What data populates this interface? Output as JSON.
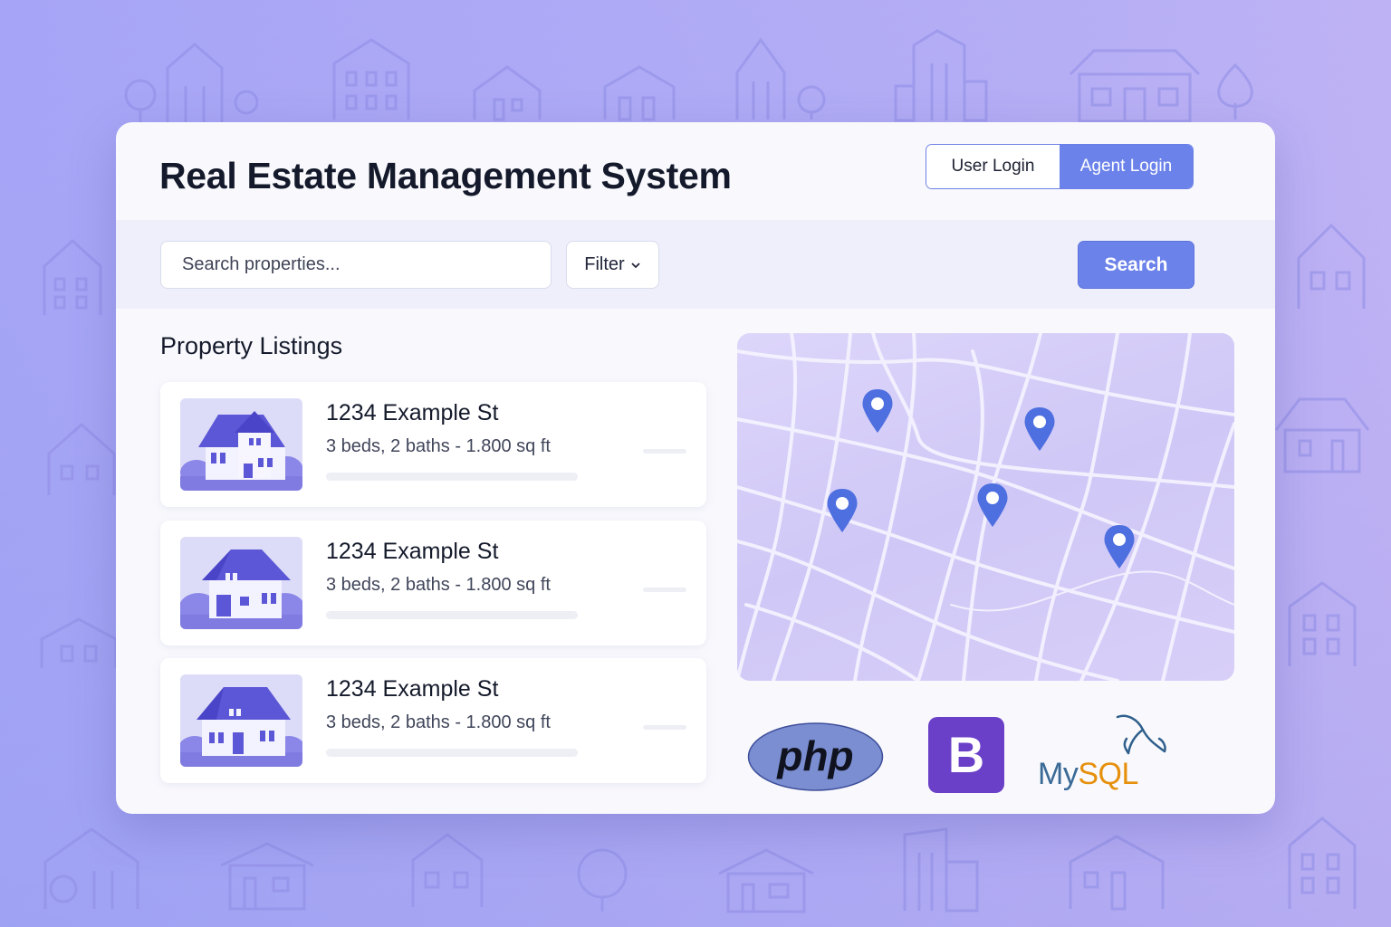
{
  "app": {
    "title": "Real Estate Management System"
  },
  "login": {
    "user_label": "User Login",
    "agent_label": "Agent Login",
    "active": "Agent Login"
  },
  "search": {
    "placeholder": "Search properties...",
    "filter_label": "Filter",
    "button_label": "Search"
  },
  "listings": {
    "title": "Property Listings",
    "items": [
      {
        "address": "1234 Example St",
        "details": "3 beds, 2 baths - 1.800 sq ft"
      },
      {
        "address": "1234 Example St",
        "details": "3 beds, 2 baths - 1.800 sq ft"
      },
      {
        "address": "1234 Example St",
        "details": "3 beds, 2 baths - 1.800 sq ft"
      }
    ]
  },
  "map": {
    "pin_count": 5
  },
  "tech_logos": {
    "php": "php",
    "bootstrap": "B",
    "mysql_my": "My",
    "mysql_sql": "SQL"
  },
  "colors": {
    "accent": "#6b82ea",
    "title": "#141a2b",
    "pin": "#4e6fe0",
    "php": "#7b8ed2",
    "bootstrap": "#6a40c8",
    "mysql_blue": "#3a6a96",
    "mysql_orange": "#e6900d"
  }
}
